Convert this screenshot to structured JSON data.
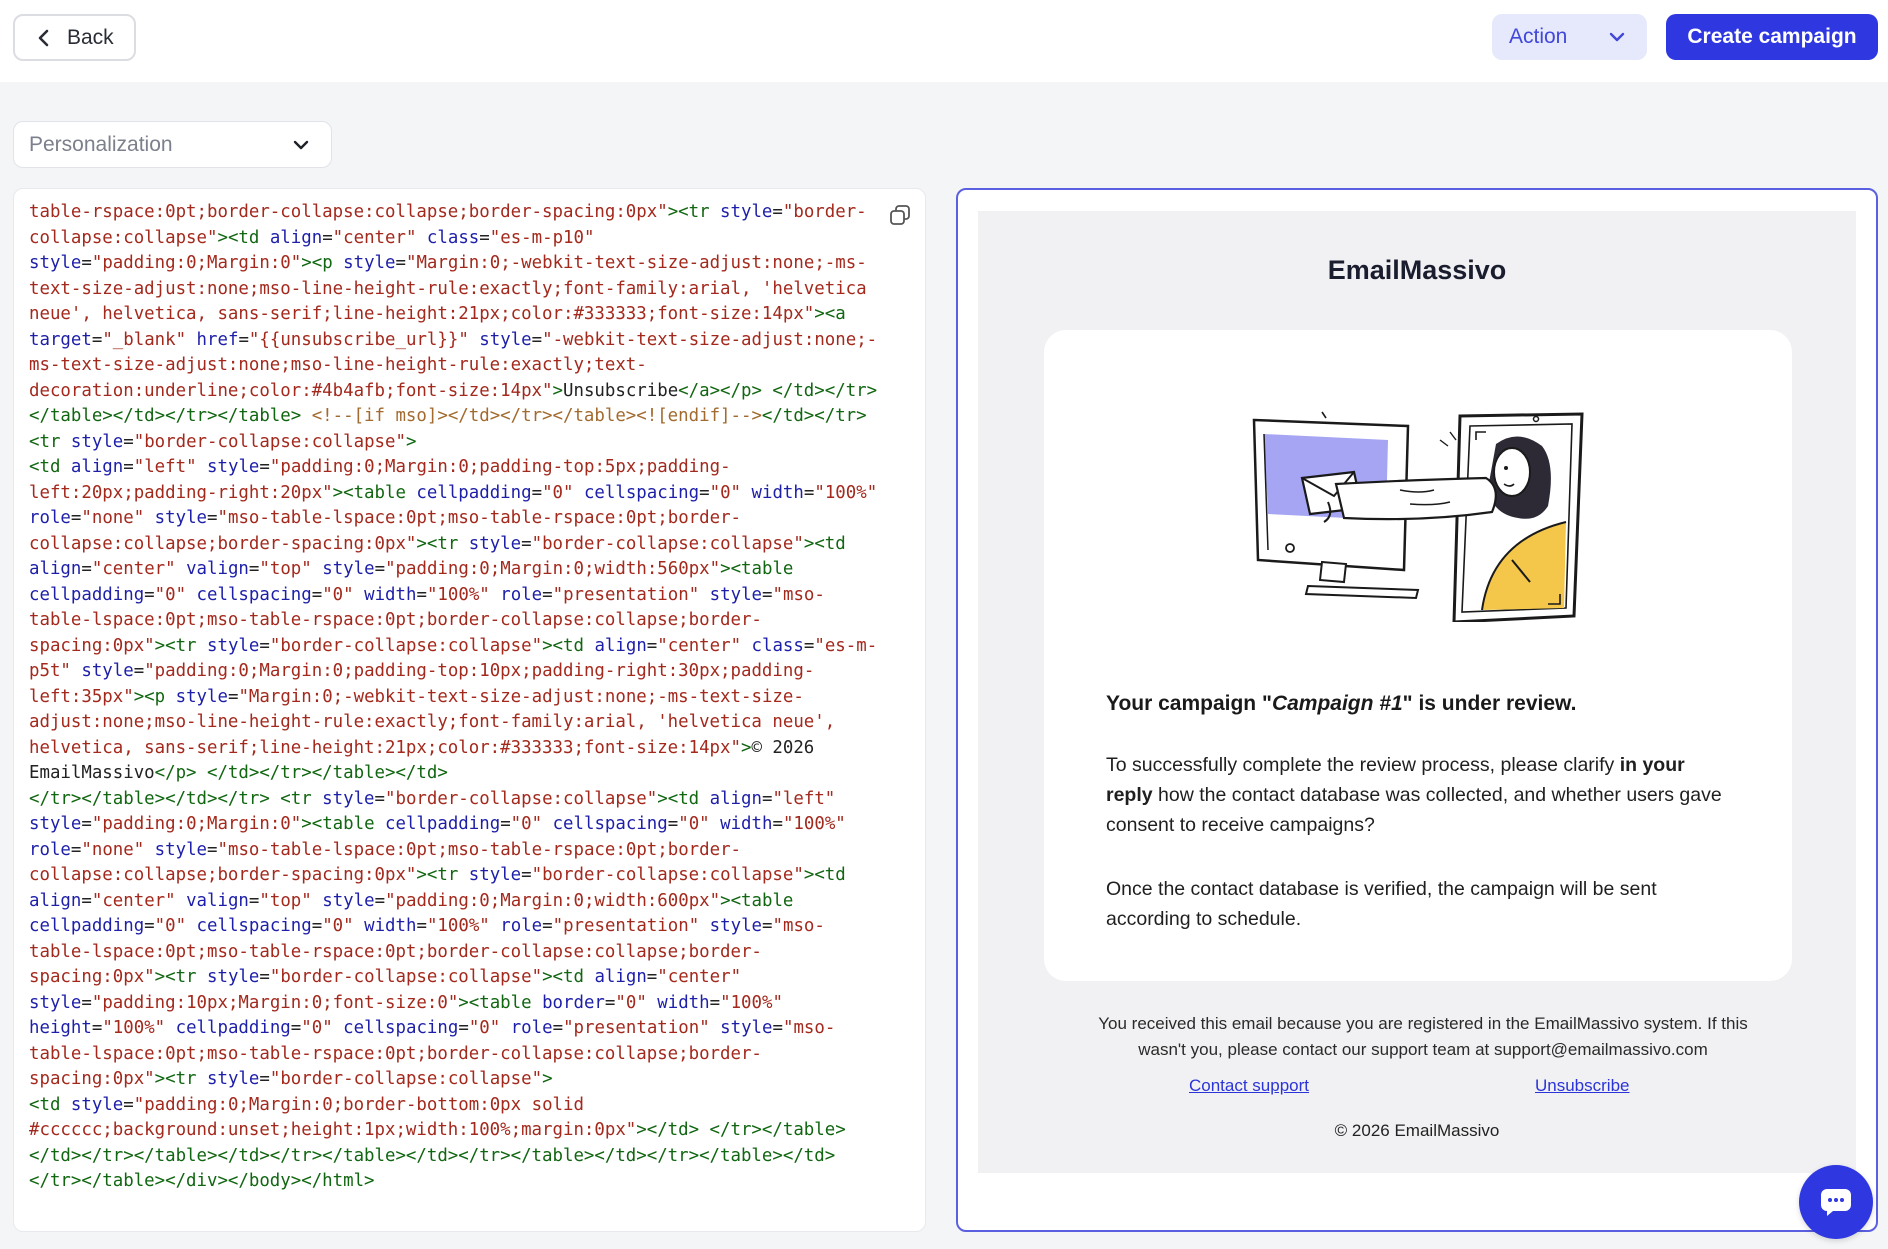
{
  "header": {
    "back_label": "Back",
    "action_label": "Action",
    "create_label": "Create campaign"
  },
  "personalization": {
    "label": "Personalization"
  },
  "code_editor": {
    "lines": [
      [
        [
          "v",
          "table-rspace:0pt;border-collapse:collapse;border-spacing:0px\""
        ],
        [
          "t",
          "><tr "
        ],
        [
          "a",
          "style"
        ],
        [
          "p",
          "="
        ],
        [
          "v",
          "\"border-"
        ]
      ],
      [
        [
          "v",
          "collapse:collapse\""
        ],
        [
          "t",
          "><td "
        ],
        [
          "a",
          "align"
        ],
        [
          "p",
          "="
        ],
        [
          "v",
          "\"center\" "
        ],
        [
          "a",
          "class"
        ],
        [
          "p",
          "="
        ],
        [
          "v",
          "\"es-m-p10\""
        ]
      ],
      [
        [
          "a",
          "style"
        ],
        [
          "p",
          "="
        ],
        [
          "v",
          "\"padding:0;Margin:0\""
        ],
        [
          "t",
          "><p "
        ],
        [
          "a",
          "style"
        ],
        [
          "p",
          "="
        ],
        [
          "v",
          "\"Margin:0;-webkit-text-size-adjust:none;-ms-"
        ]
      ],
      [
        [
          "v",
          "text-size-adjust:none;mso-line-height-rule:exactly;font-family:arial, 'helvetica"
        ]
      ],
      [
        [
          "v",
          "neue', helvetica, sans-serif;line-height:21px;color:#333333;font-size:14px\""
        ],
        [
          "t",
          "><a"
        ]
      ],
      [
        [
          "a",
          "target"
        ],
        [
          "p",
          "="
        ],
        [
          "v",
          "\"_blank\" "
        ],
        [
          "a",
          "href"
        ],
        [
          "p",
          "="
        ],
        [
          "v",
          "\"{{unsubscribe_url}}\" "
        ],
        [
          "a",
          "style"
        ],
        [
          "p",
          "="
        ],
        [
          "v",
          "\"-webkit-text-size-adjust:none;-"
        ]
      ],
      [
        [
          "v",
          "ms-text-size-adjust:none;mso-line-height-rule:exactly;text-"
        ]
      ],
      [
        [
          "v",
          "decoration:underline;color:#4b4afb;font-size:14px\""
        ],
        [
          "t",
          ">"
        ],
        [
          "p",
          "Unsubscribe"
        ],
        [
          "t",
          "</a></p> </td></tr>"
        ]
      ],
      [
        [
          "t",
          "</table></td></tr></table> "
        ],
        [
          "c",
          "<!--[if mso]></td></tr></table><![endif]-->"
        ],
        [
          "t",
          "</td></tr>"
        ]
      ],
      [
        [
          "t",
          "<tr "
        ],
        [
          "a",
          "style"
        ],
        [
          "p",
          "="
        ],
        [
          "v",
          "\"border-collapse:collapse\""
        ],
        [
          "t",
          ">"
        ]
      ],
      [
        [
          "t",
          "<td "
        ],
        [
          "a",
          "align"
        ],
        [
          "p",
          "="
        ],
        [
          "v",
          "\"left\" "
        ],
        [
          "a",
          "style"
        ],
        [
          "p",
          "="
        ],
        [
          "v",
          "\"padding:0;Margin:0;padding-top:5px;padding-"
        ]
      ],
      [
        [
          "v",
          "left:20px;padding-right:20px\""
        ],
        [
          "t",
          "><table "
        ],
        [
          "a",
          "cellpadding"
        ],
        [
          "p",
          "="
        ],
        [
          "v",
          "\"0\" "
        ],
        [
          "a",
          "cellspacing"
        ],
        [
          "p",
          "="
        ],
        [
          "v",
          "\"0\" "
        ],
        [
          "a",
          "width"
        ],
        [
          "p",
          "="
        ],
        [
          "v",
          "\"100%\""
        ]
      ],
      [
        [
          "a",
          "role"
        ],
        [
          "p",
          "="
        ],
        [
          "v",
          "\"none\" "
        ],
        [
          "a",
          "style"
        ],
        [
          "p",
          "="
        ],
        [
          "v",
          "\"mso-table-lspace:0pt;mso-table-rspace:0pt;border-"
        ]
      ],
      [
        [
          "v",
          "collapse:collapse;border-spacing:0px\""
        ],
        [
          "t",
          "><tr "
        ],
        [
          "a",
          "style"
        ],
        [
          "p",
          "="
        ],
        [
          "v",
          "\"border-collapse:collapse\""
        ],
        [
          "t",
          "><td"
        ]
      ],
      [
        [
          "a",
          "align"
        ],
        [
          "p",
          "="
        ],
        [
          "v",
          "\"center\" "
        ],
        [
          "a",
          "valign"
        ],
        [
          "p",
          "="
        ],
        [
          "v",
          "\"top\" "
        ],
        [
          "a",
          "style"
        ],
        [
          "p",
          "="
        ],
        [
          "v",
          "\"padding:0;Margin:0;width:560px\""
        ],
        [
          "t",
          "><table"
        ]
      ],
      [
        [
          "a",
          "cellpadding"
        ],
        [
          "p",
          "="
        ],
        [
          "v",
          "\"0\" "
        ],
        [
          "a",
          "cellspacing"
        ],
        [
          "p",
          "="
        ],
        [
          "v",
          "\"0\" "
        ],
        [
          "a",
          "width"
        ],
        [
          "p",
          "="
        ],
        [
          "v",
          "\"100%\" "
        ],
        [
          "a",
          "role"
        ],
        [
          "p",
          "="
        ],
        [
          "v",
          "\"presentation\" "
        ],
        [
          "a",
          "style"
        ],
        [
          "p",
          "="
        ],
        [
          "v",
          "\"mso-"
        ]
      ],
      [
        [
          "v",
          "table-lspace:0pt;mso-table-rspace:0pt;border-collapse:collapse;border-"
        ]
      ],
      [
        [
          "v",
          "spacing:0px\""
        ],
        [
          "t",
          "><tr "
        ],
        [
          "a",
          "style"
        ],
        [
          "p",
          "="
        ],
        [
          "v",
          "\"border-collapse:collapse\""
        ],
        [
          "t",
          "><td "
        ],
        [
          "a",
          "align"
        ],
        [
          "p",
          "="
        ],
        [
          "v",
          "\"center\" "
        ],
        [
          "a",
          "class"
        ],
        [
          "p",
          "="
        ],
        [
          "v",
          "\"es-m-"
        ]
      ],
      [
        [
          "v",
          "p5t\" "
        ],
        [
          "a",
          "style"
        ],
        [
          "p",
          "="
        ],
        [
          "v",
          "\"padding:0;Margin:0;padding-top:10px;padding-right:30px;padding-"
        ]
      ],
      [
        [
          "v",
          "left:35px\""
        ],
        [
          "t",
          "><p "
        ],
        [
          "a",
          "style"
        ],
        [
          "p",
          "="
        ],
        [
          "v",
          "\"Margin:0;-webkit-text-size-adjust:none;-ms-text-size-"
        ]
      ],
      [
        [
          "v",
          "adjust:none;mso-line-height-rule:exactly;font-family:arial, 'helvetica neue',"
        ]
      ],
      [
        [
          "v",
          "helvetica, sans-serif;line-height:21px;color:#333333;font-size:14px\""
        ],
        [
          "t",
          ">"
        ],
        [
          "p",
          "© 2026"
        ]
      ],
      [
        [
          "p",
          "EmailMassivo"
        ],
        [
          "t",
          "</p> </td></tr></table></td>"
        ]
      ],
      [
        [
          "t",
          "</tr></table></td></tr> <tr "
        ],
        [
          "a",
          "style"
        ],
        [
          "p",
          "="
        ],
        [
          "v",
          "\"border-collapse:collapse\""
        ],
        [
          "t",
          "><td "
        ],
        [
          "a",
          "align"
        ],
        [
          "p",
          "="
        ],
        [
          "v",
          "\"left\""
        ]
      ],
      [
        [
          "a",
          "style"
        ],
        [
          "p",
          "="
        ],
        [
          "v",
          "\"padding:0;Margin:0\""
        ],
        [
          "t",
          "><table "
        ],
        [
          "a",
          "cellpadding"
        ],
        [
          "p",
          "="
        ],
        [
          "v",
          "\"0\" "
        ],
        [
          "a",
          "cellspacing"
        ],
        [
          "p",
          "="
        ],
        [
          "v",
          "\"0\" "
        ],
        [
          "a",
          "width"
        ],
        [
          "p",
          "="
        ],
        [
          "v",
          "\"100%\""
        ]
      ],
      [
        [
          "a",
          "role"
        ],
        [
          "p",
          "="
        ],
        [
          "v",
          "\"none\" "
        ],
        [
          "a",
          "style"
        ],
        [
          "p",
          "="
        ],
        [
          "v",
          "\"mso-table-lspace:0pt;mso-table-rspace:0pt;border-"
        ]
      ],
      [
        [
          "v",
          "collapse:collapse;border-spacing:0px\""
        ],
        [
          "t",
          "><tr "
        ],
        [
          "a",
          "style"
        ],
        [
          "p",
          "="
        ],
        [
          "v",
          "\"border-collapse:collapse\""
        ],
        [
          "t",
          "><td"
        ]
      ],
      [
        [
          "a",
          "align"
        ],
        [
          "p",
          "="
        ],
        [
          "v",
          "\"center\" "
        ],
        [
          "a",
          "valign"
        ],
        [
          "p",
          "="
        ],
        [
          "v",
          "\"top\" "
        ],
        [
          "a",
          "style"
        ],
        [
          "p",
          "="
        ],
        [
          "v",
          "\"padding:0;Margin:0;width:600px\""
        ],
        [
          "t",
          "><table"
        ]
      ],
      [
        [
          "a",
          "cellpadding"
        ],
        [
          "p",
          "="
        ],
        [
          "v",
          "\"0\" "
        ],
        [
          "a",
          "cellspacing"
        ],
        [
          "p",
          "="
        ],
        [
          "v",
          "\"0\" "
        ],
        [
          "a",
          "width"
        ],
        [
          "p",
          "="
        ],
        [
          "v",
          "\"100%\" "
        ],
        [
          "a",
          "role"
        ],
        [
          "p",
          "="
        ],
        [
          "v",
          "\"presentation\" "
        ],
        [
          "a",
          "style"
        ],
        [
          "p",
          "="
        ],
        [
          "v",
          "\"mso-"
        ]
      ],
      [
        [
          "v",
          "table-lspace:0pt;mso-table-rspace:0pt;border-collapse:collapse;border-"
        ]
      ],
      [
        [
          "v",
          "spacing:0px\""
        ],
        [
          "t",
          "><tr "
        ],
        [
          "a",
          "style"
        ],
        [
          "p",
          "="
        ],
        [
          "v",
          "\"border-collapse:collapse\""
        ],
        [
          "t",
          "><td "
        ],
        [
          "a",
          "align"
        ],
        [
          "p",
          "="
        ],
        [
          "v",
          "\"center\""
        ]
      ],
      [
        [
          "a",
          "style"
        ],
        [
          "p",
          "="
        ],
        [
          "v",
          "\"padding:10px;Margin:0;font-size:0\""
        ],
        [
          "t",
          "><table "
        ],
        [
          "a",
          "border"
        ],
        [
          "p",
          "="
        ],
        [
          "v",
          "\"0\" "
        ],
        [
          "a",
          "width"
        ],
        [
          "p",
          "="
        ],
        [
          "v",
          "\"100%\""
        ]
      ],
      [
        [
          "a",
          "height"
        ],
        [
          "p",
          "="
        ],
        [
          "v",
          "\"100%\" "
        ],
        [
          "a",
          "cellpadding"
        ],
        [
          "p",
          "="
        ],
        [
          "v",
          "\"0\" "
        ],
        [
          "a",
          "cellspacing"
        ],
        [
          "p",
          "="
        ],
        [
          "v",
          "\"0\" "
        ],
        [
          "a",
          "role"
        ],
        [
          "p",
          "="
        ],
        [
          "v",
          "\"presentation\" "
        ],
        [
          "a",
          "style"
        ],
        [
          "p",
          "="
        ],
        [
          "v",
          "\"mso-"
        ]
      ],
      [
        [
          "v",
          "table-lspace:0pt;mso-table-rspace:0pt;border-collapse:collapse;border-"
        ]
      ],
      [
        [
          "v",
          "spacing:0px\""
        ],
        [
          "t",
          "><tr "
        ],
        [
          "a",
          "style"
        ],
        [
          "p",
          "="
        ],
        [
          "v",
          "\"border-collapse:collapse\""
        ],
        [
          "t",
          ">"
        ]
      ],
      [
        [
          "t",
          "<td "
        ],
        [
          "a",
          "style"
        ],
        [
          "p",
          "="
        ],
        [
          "v",
          "\"padding:0;Margin:0;border-bottom:0px solid"
        ]
      ],
      [
        [
          "v",
          "#cccccc;background:unset;height:1px;width:100%;margin:0px\""
        ],
        [
          "t",
          "></td> </tr></table>"
        ]
      ],
      [
        [
          "t",
          "</td></tr></table></td></tr></table></td></tr></table></td></tr></table></td>"
        ]
      ],
      [
        [
          "t",
          "</tr></table></div></body></html>"
        ]
      ]
    ]
  },
  "preview": {
    "brand": "EmailMassivo",
    "heading_prefix": "Your campaign \"",
    "heading_campaign": "Campaign #1",
    "heading_suffix": "\" is under review.",
    "para1_a": "To successfully complete the review process, please clarify ",
    "para1_bold": "in your reply",
    "para1_b": " how the contact database was collected, and whether users gave consent to receive campaigns?",
    "para2": "Once the contact database is verified, the campaign will be sent according to schedule.",
    "footer_text": "You received this email because you are registered in the EmailMassivo system. If this wasn't you, please contact our support team at support@emailmassivo.com",
    "contact_link": "Contact support",
    "unsubscribe_link": "Unsubscribe",
    "copyright": "© 2026 EmailMassivo"
  },
  "colors": {
    "accent": "#2f37e0",
    "action_bg": "#e6e8fb",
    "illustration_purple": "#a6a5f3",
    "illustration_yellow": "#f4c74b"
  }
}
